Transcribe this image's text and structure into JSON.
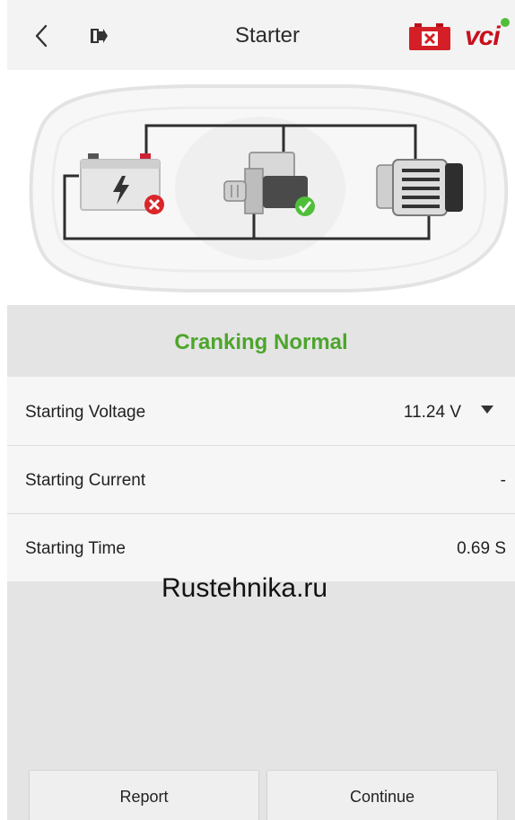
{
  "header": {
    "title": "Starter",
    "back_icon": "chevron-left-icon",
    "exit_icon": "exit-icon",
    "battery_icon": "battery-error-icon",
    "vci_label": "vci"
  },
  "diagram": {
    "battery_status": "error",
    "starter_status": "ok",
    "icons": [
      "battery-icon",
      "starter-motor-icon",
      "alternator-icon",
      "error-badge-icon",
      "check-badge-icon"
    ]
  },
  "status": {
    "text": "Cranking Normal",
    "color": "#4ea52c"
  },
  "rows": [
    {
      "label": "Starting Voltage",
      "value": "11.24 V",
      "has_dropdown": true
    },
    {
      "label": "Starting Current",
      "value": "-",
      "has_dropdown": false
    },
    {
      "label": "Starting Time",
      "value": "0.69 S",
      "has_dropdown": false
    }
  ],
  "watermark": "Rustehnika.ru",
  "buttons": {
    "report": "Report",
    "continue": "Continue"
  },
  "colors": {
    "accent_green": "#4ea52c",
    "error_red": "#d9262a",
    "vci_red": "#c8101c",
    "vci_dot_green": "#4fbf3a"
  }
}
